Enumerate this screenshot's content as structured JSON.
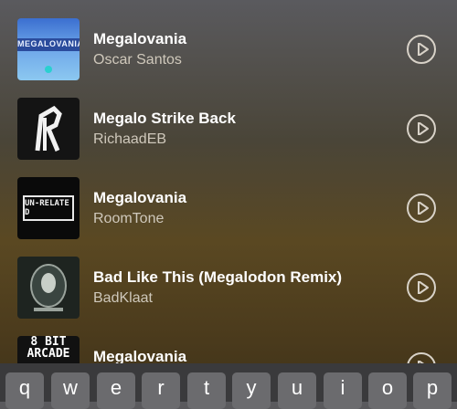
{
  "results": [
    {
      "title": "Megalovania",
      "artist": "Oscar Santos",
      "art_text": "MEGALOVANIA"
    },
    {
      "title": "Megalo Strike Back",
      "artist": "RichaadEB",
      "art_text": ""
    },
    {
      "title": "Megalovania",
      "artist": "RoomTone",
      "art_text": "UN-RELATED"
    },
    {
      "title": "Bad Like This (Megalodon Remix)",
      "artist": "BadKlaat",
      "art_text": ""
    },
    {
      "title": "Megalovania",
      "artist": "",
      "art_text": "8 BIT ARCADE"
    }
  ],
  "keyboard": {
    "keys": [
      "q",
      "w",
      "e",
      "r",
      "t",
      "y",
      "u",
      "i",
      "o",
      "p"
    ]
  },
  "colors": {
    "accent": "#ffffff",
    "secondary_text": "#cfc8bb",
    "key_bg": "#6b6b6e",
    "keyboard_bg": "#3a3a3c"
  }
}
